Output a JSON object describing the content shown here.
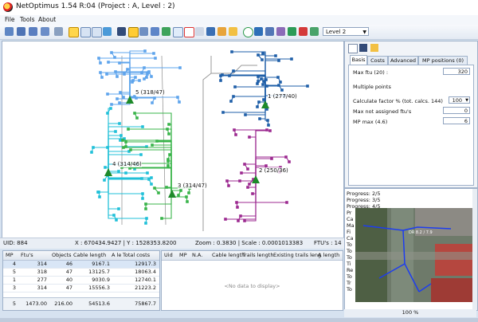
{
  "window": {
    "title": "NetOptimus 1.54 R:04 (Project : A, Level : 2)"
  },
  "menu": {
    "file": "File",
    "tools": "Tools",
    "about": "About"
  },
  "toolbar": {
    "level_select": "Level 2"
  },
  "map": {
    "labels": {
      "mp1": "1 (277/40)",
      "mp2": "2 (250/36)",
      "mp3": "3 (314/47)",
      "mp4": "4 (314/46)",
      "mp5": "5 (318/47)"
    },
    "colors": {
      "mp1": "#1f5fa8",
      "mp2": "#9c2a90",
      "mp3": "#39b44a",
      "mp4": "#20c0d8",
      "mp5": "#5ea4ec"
    }
  },
  "status": {
    "uid": "UID: 884",
    "xy": "X : 670434.9427 | Y : 1528353.8200",
    "zoom": "Zoom : 0.3830 | Scale : 0.0001013383",
    "ftu": "FTU's : 14"
  },
  "mp_table": {
    "headers": [
      "MP",
      "Ftu's",
      "Objects",
      "Cable length",
      "A le",
      "Total costs"
    ],
    "rows": [
      [
        "4",
        "314",
        "46",
        "9167.1",
        "",
        "12917.3"
      ],
      [
        "5",
        "318",
        "47",
        "13125.7",
        "",
        "18063.4"
      ],
      [
        "1",
        "277",
        "40",
        "9030.9",
        "",
        "12740.1"
      ],
      [
        "3",
        "314",
        "47",
        "15556.3",
        "",
        "21223.2"
      ]
    ],
    "summary": [
      "5",
      "1473.00",
      "216.00",
      "54513.6",
      "",
      "75867.7"
    ]
  },
  "detail_table": {
    "headers": [
      "Uid",
      "MP",
      "N.A.",
      "Cable length",
      "Trails length",
      "Existing trails leng",
      "A length"
    ],
    "empty_text": "<No data to display>"
  },
  "right_panel": {
    "tabs": [
      "Basis",
      "Costs",
      "Advanced",
      "MP positions (0)"
    ],
    "max_ftu_label": "Max ftu (20) :",
    "max_ftu_value": "320",
    "multiple_points_label": "Multiple points",
    "calc_factor_label": "Calculate factor % (tot. calcs. 144)",
    "calc_factor_value": "100",
    "max_not_assigned_label": "Max not assigned ftu's",
    "max_not_assigned_value": "0",
    "mp_max_label": "MP max (4.6)",
    "mp_max_value": "6"
  },
  "log": {
    "lines": [
      "Progress: 2/5",
      "Progress: 3/5",
      "Progress: 4/5",
      "Pr",
      "Ca",
      "Ma",
      "Fi",
      "Ca",
      "To",
      "To",
      "To",
      "Ti",
      "Re",
      "To",
      "Tr",
      "To"
    ],
    "image_label": "DR 8.2 / 7.9"
  },
  "zoom_footer": "100 %"
}
